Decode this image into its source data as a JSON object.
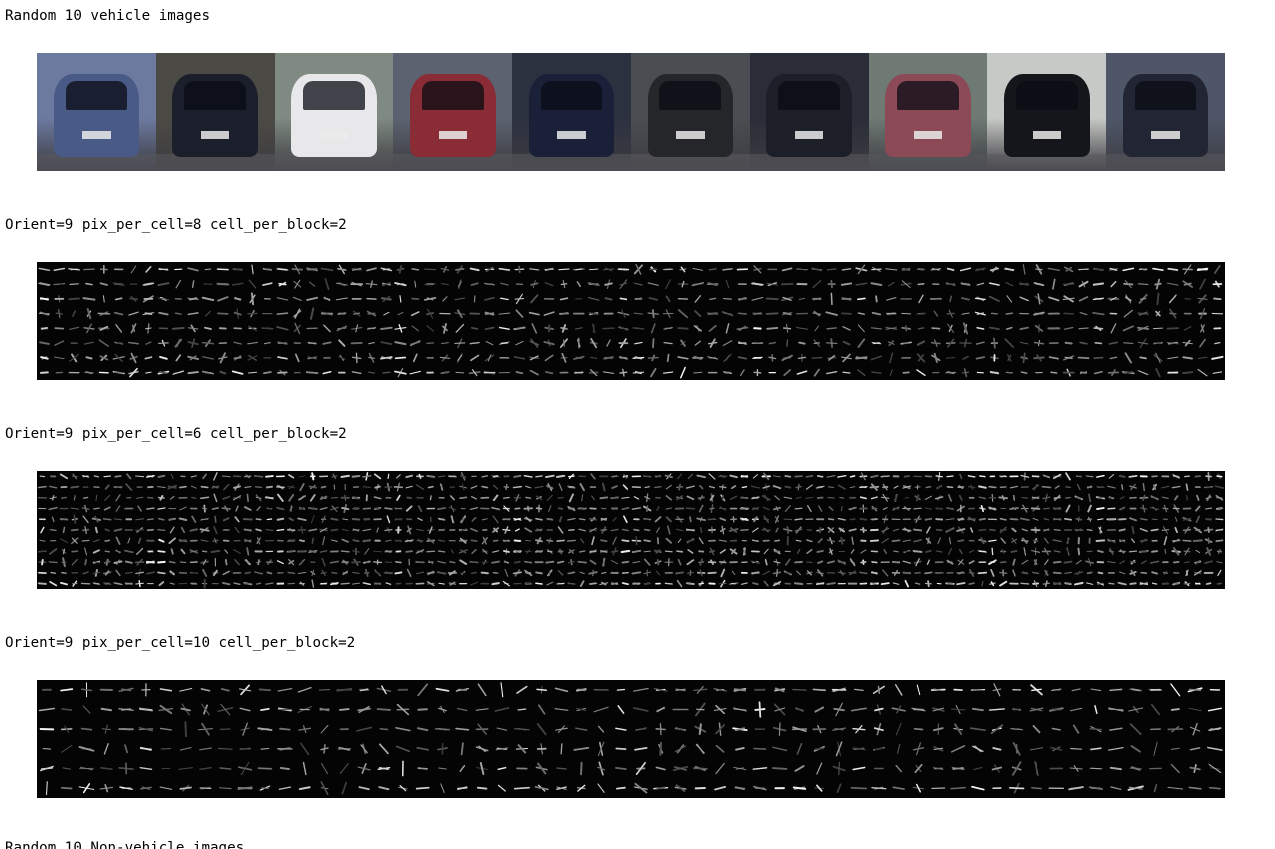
{
  "notebook_output": {
    "header_vehicle": "Random 10 vehicle images",
    "hog_rows": [
      {
        "label": "Orient=9 pix_per_cell=8 cell_per_block=2",
        "orient": 9,
        "pix_per_cell": 8,
        "cell_per_block": 2
      },
      {
        "label": "Orient=9 pix_per_cell=6 cell_per_block=2",
        "orient": 9,
        "pix_per_cell": 6,
        "cell_per_block": 2
      },
      {
        "label": "Orient=9 pix_per_cell=10 cell_per_block=2",
        "orient": 9,
        "pix_per_cell": 10,
        "cell_per_block": 2
      }
    ],
    "header_nonvehicle_partial": "Random 10 Non-vehicle images"
  },
  "vehicle_images": [
    {
      "bg": "#6d7aa0",
      "car": "#4a5a86"
    },
    {
      "bg": "#4c4a44",
      "car": "#1b1f2c"
    },
    {
      "bg": "#7f8a82",
      "car": "#e8e8ea"
    },
    {
      "bg": "#5c6270",
      "car": "#8a2c36"
    },
    {
      "bg": "#2c3140",
      "car": "#1a2038"
    },
    {
      "bg": "#4a4d52",
      "car": "#24262a"
    },
    {
      "bg": "#2a2d38",
      "car": "#1c1e28"
    },
    {
      "bg": "#6f7a74",
      "car": "#8b4a55"
    },
    {
      "bg": "#c7c9c6",
      "car": "#15161c"
    },
    {
      "bg": "#4e5668",
      "car": "#222533"
    }
  ]
}
